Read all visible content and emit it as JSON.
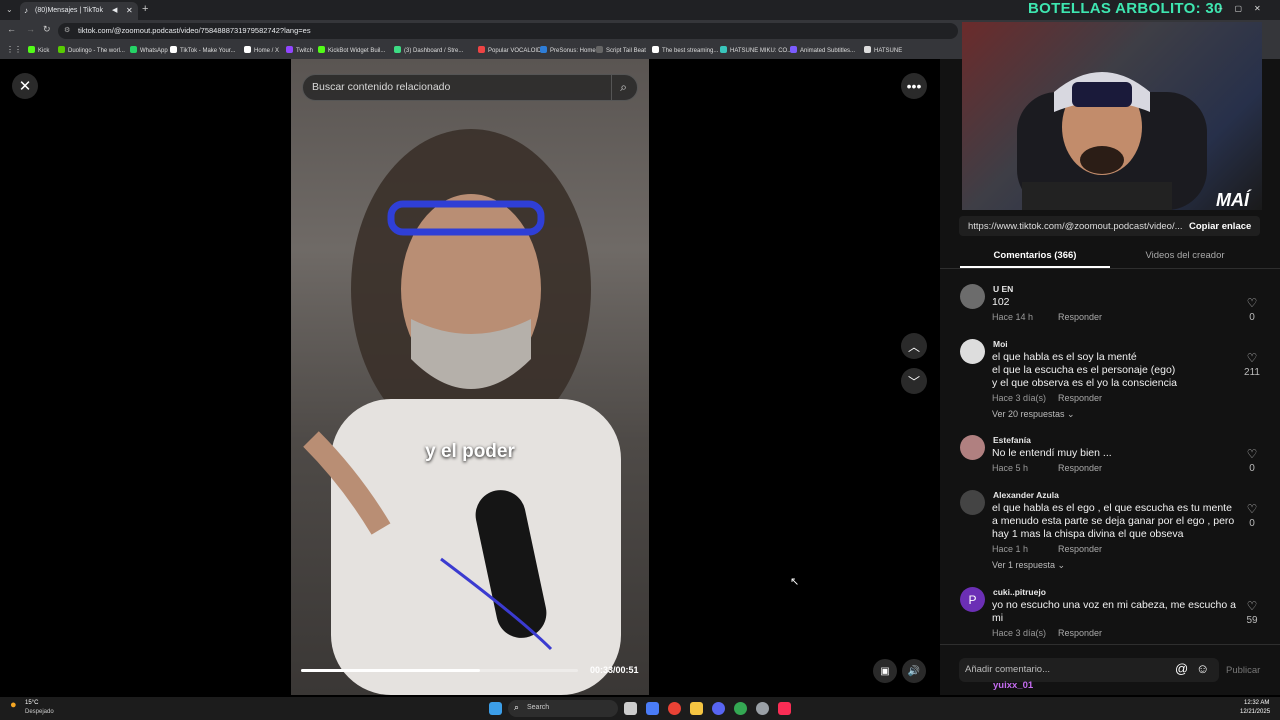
{
  "browser": {
    "tab_title": "(80)Mensajes | TikTok",
    "url": "tiktok.com/@zoomout.podcast/video/7584888731979582742?lang=es",
    "bookmarks": [
      {
        "label": "Kick",
        "color": "#53fc18"
      },
      {
        "label": "Duolingo - The worl...",
        "color": "#58cc02"
      },
      {
        "label": "WhatsApp",
        "color": "#25d366"
      },
      {
        "label": "TikTok - Make Your...",
        "color": "#ffffff"
      },
      {
        "label": "Home / X",
        "color": "#ffffff"
      },
      {
        "label": "Twitch",
        "color": "#9146ff"
      },
      {
        "label": "KickBot Widget Buil...",
        "color": "#53fc18"
      },
      {
        "label": "(3) Dashboard / Stre...",
        "color": "#3ddc84"
      },
      {
        "label": "Popular VOCALOID...",
        "color": "#e44"
      },
      {
        "label": "PreSonus: Home",
        "color": "#2e7dd7"
      },
      {
        "label": "Script Tail Beat",
        "color": "#666"
      },
      {
        "label": "The best streaming...",
        "color": "#fff"
      },
      {
        "label": "HATSUNE MIKU: CO...",
        "color": "#39c5bb"
      },
      {
        "label": "Animated Subtitles...",
        "color": "#7b5cff"
      },
      {
        "label": "HATSUNE",
        "color": "#ddd"
      }
    ]
  },
  "overlay": {
    "counter_text": "BOTELLAS ARBOLITO: 30",
    "logo_text": "MAÍ"
  },
  "video": {
    "search_placeholder": "Buscar contenido relacionado",
    "caption": "y el poder",
    "time": "00:33/00:51",
    "progress": 0.647
  },
  "panel": {
    "link": "https://www.tiktok.com/@zoomout.podcast/video/...",
    "copy_label": "Copiar enlace",
    "tab_comments": "Comentarios (366)",
    "tab_creator": "Videos del creador",
    "reply_label": "Responder",
    "add_comment_placeholder": "Añadir comentario...",
    "publish_label": "Publicar",
    "below_user": "yuixx_01"
  },
  "comments": [
    {
      "name": "U EN",
      "text": "102",
      "time": "Hace 14 h",
      "likes": "0",
      "more": "",
      "avatar": "#6c6c6c"
    },
    {
      "name": "Moi",
      "text": "el que habla es el soy la menté\nel que la escucha es el personaje (ego)\ny el que observa es el yo la consciencia",
      "time": "Hace 3 día(s)",
      "likes": "211",
      "more": "Ver 20 respuestas",
      "avatar": "#ddd"
    },
    {
      "name": "Estefanía",
      "text": "No le entendí muy bien ...",
      "time": "Hace 5 h",
      "likes": "0",
      "more": "",
      "avatar": "#b08080"
    },
    {
      "name": "Alexander Azula",
      "text": "el que habla es el ego , el que escucha es tu mente\na menudo esta parte se deja ganar por el ego , pero\nhay 1 mas la chispa divina el que obseva",
      "time": "Hace 1 h",
      "likes": "0",
      "more": "Ver 1 respuesta",
      "avatar": "#444"
    },
    {
      "name": "cuki..pitruejo",
      "text": "yo no escucho una voz en mi cabeza, me escucho a\nmi",
      "time": "Hace 3 día(s)",
      "likes": "59",
      "more": "",
      "avatar": "#6b2fb5",
      "letter": "P"
    }
  ],
  "taskbar": {
    "weather_temp": "15°C",
    "weather_text": "Despejado",
    "search_label": "Search",
    "clock_time": "12:32 AM",
    "clock_date": "12/21/2025"
  }
}
